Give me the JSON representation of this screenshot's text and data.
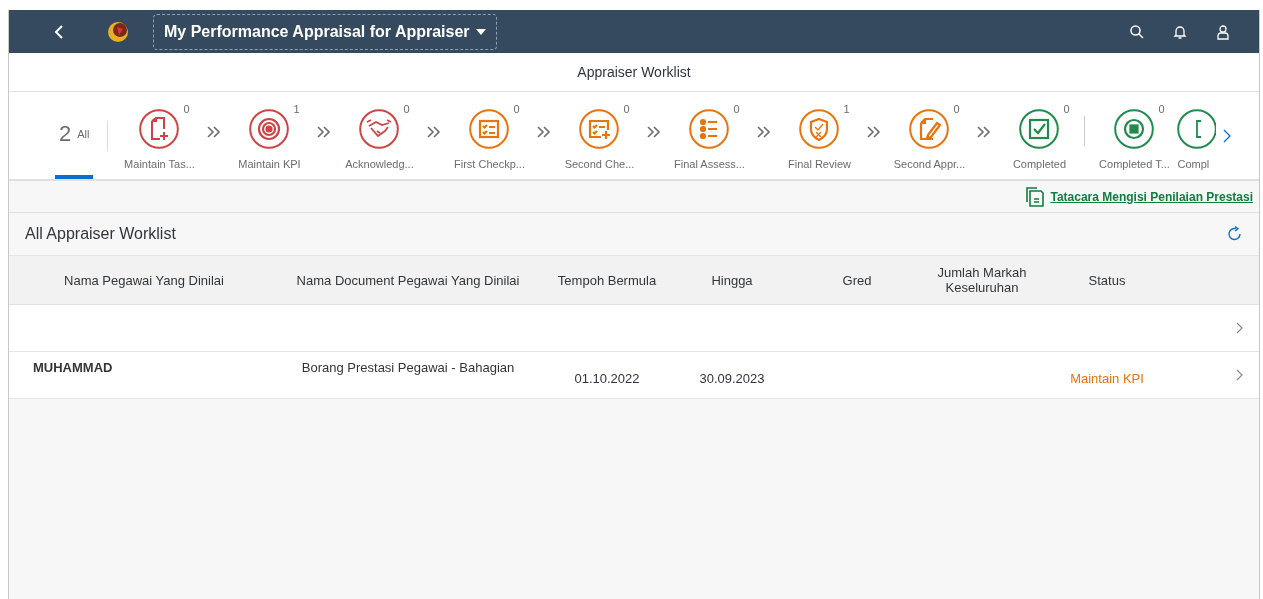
{
  "shell": {
    "title": "My Performance Appraisal for Appraiser"
  },
  "page_title": "Appraiser Worklist",
  "filter": {
    "all": {
      "count": "2",
      "label": "All",
      "selected": true
    },
    "steps": [
      {
        "kind": "doc-plus",
        "color": "#d04343",
        "count": "0",
        "label": "Maintain Tas...",
        "selected": false,
        "chevron_before": false,
        "divider_before": false
      },
      {
        "kind": "target",
        "color": "#d04343",
        "count": "1",
        "label": "Maintain KPI",
        "selected": false,
        "chevron_before": true,
        "divider_before": false
      },
      {
        "kind": "handshake",
        "color": "#d04343",
        "count": "0",
        "label": "Acknowledg...",
        "selected": false,
        "chevron_before": true,
        "divider_before": false
      },
      {
        "kind": "checklist",
        "color": "#e9730c",
        "count": "0",
        "label": "First Checkp...",
        "selected": false,
        "chevron_before": true,
        "divider_before": false
      },
      {
        "kind": "checklist-plus",
        "color": "#e9730c",
        "count": "0",
        "label": "Second Che...",
        "selected": false,
        "chevron_before": true,
        "divider_before": false
      },
      {
        "kind": "bullets",
        "color": "#e9730c",
        "count": "0",
        "label": "Final Assess...",
        "selected": false,
        "chevron_before": true,
        "divider_before": false
      },
      {
        "kind": "shield",
        "color": "#e9730c",
        "count": "1",
        "label": "Final Review",
        "selected": false,
        "chevron_before": true,
        "divider_before": false
      },
      {
        "kind": "doc-pen",
        "color": "#e9730c",
        "count": "0",
        "label": "Second Appr...",
        "selected": false,
        "chevron_before": true,
        "divider_before": false
      },
      {
        "kind": "checkbox",
        "color": "#1f8b4c",
        "count": "0",
        "label": "Completed",
        "selected": false,
        "chevron_before": true,
        "divider_before": false
      },
      {
        "kind": "stop",
        "color": "#1f8b4c",
        "count": "0",
        "label": "Completed T...",
        "selected": false,
        "chevron_before": false,
        "divider_before": true
      },
      {
        "kind": "partial",
        "color": "#1f8b4c",
        "label": "Compl",
        "selected": false,
        "chevron_before": false,
        "divider_before": false
      }
    ]
  },
  "guide_link": "Tatacara Mengisi Penilaian Prestasi",
  "table": {
    "title": "All Appraiser Worklist",
    "columns": [
      "Nama Pegawai Yang Dinilai",
      "Nama Document Pegawai Yang Dinilai",
      "Tempoh Bermula",
      "Hingga",
      "Gred",
      "Jumlah Markah Keseluruhan",
      "Status"
    ],
    "rows": [
      {
        "name": "",
        "document": "",
        "start": "",
        "end": "",
        "grade": "",
        "total": "",
        "status": ""
      },
      {
        "name": "MUHAMMAD",
        "document": "Borang Prestasi Pegawai - Bahagian",
        "start": "01.10.2022",
        "end": "30.09.2023",
        "grade": "",
        "total": "",
        "status": "Maintain KPI"
      }
    ]
  }
}
